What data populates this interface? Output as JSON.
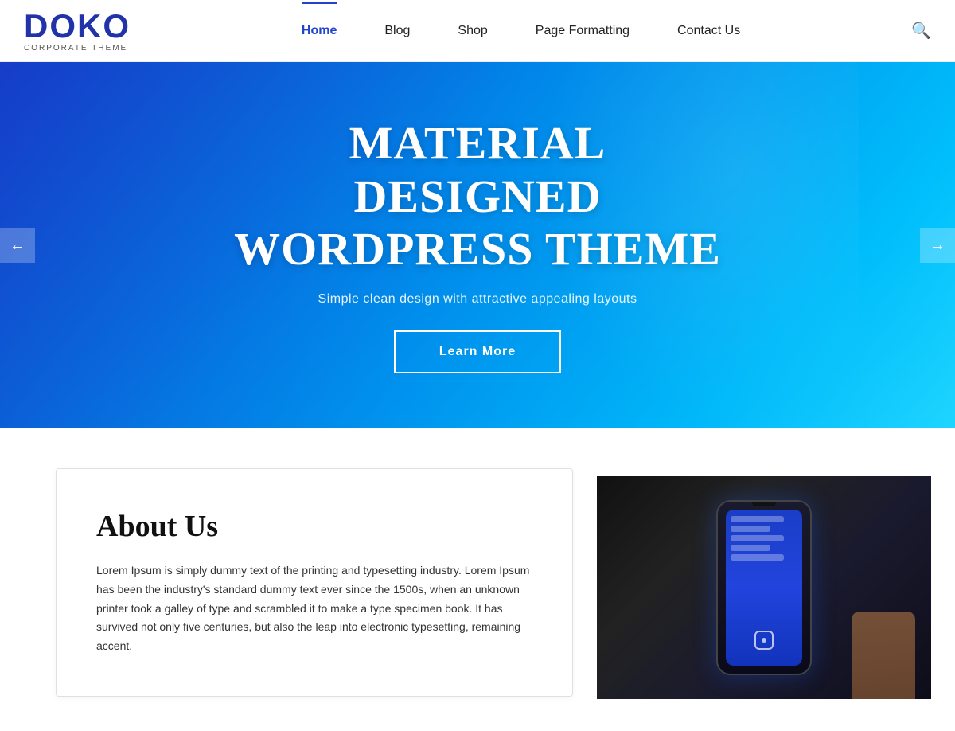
{
  "header": {
    "logo": {
      "name": "DOKO",
      "subtitle": "Corporate Theme"
    },
    "nav": {
      "items": [
        {
          "label": "Home",
          "active": true
        },
        {
          "label": "Blog",
          "active": false
        },
        {
          "label": "Shop",
          "active": false
        },
        {
          "label": "Page Formatting",
          "active": false
        },
        {
          "label": "Contact Us",
          "active": false
        }
      ]
    },
    "search_icon": "🔍"
  },
  "hero": {
    "title": "MATERIAL DESIGNED WORDPRESS THEME",
    "subtitle": "Simple clean design with attractive appealing layouts",
    "cta_label": "Learn More",
    "arrow_left": "←",
    "arrow_right": "→"
  },
  "about": {
    "title": "About Us",
    "body": "Lorem Ipsum is simply dummy text of the printing and typesetting industry. Lorem Ipsum has been the industry's standard dummy text ever since the 1500s, when an unknown printer took a galley of type and scrambled it to make a type specimen book. It has survived not only five centuries, but also the leap into electronic typesetting, remaining accent."
  }
}
